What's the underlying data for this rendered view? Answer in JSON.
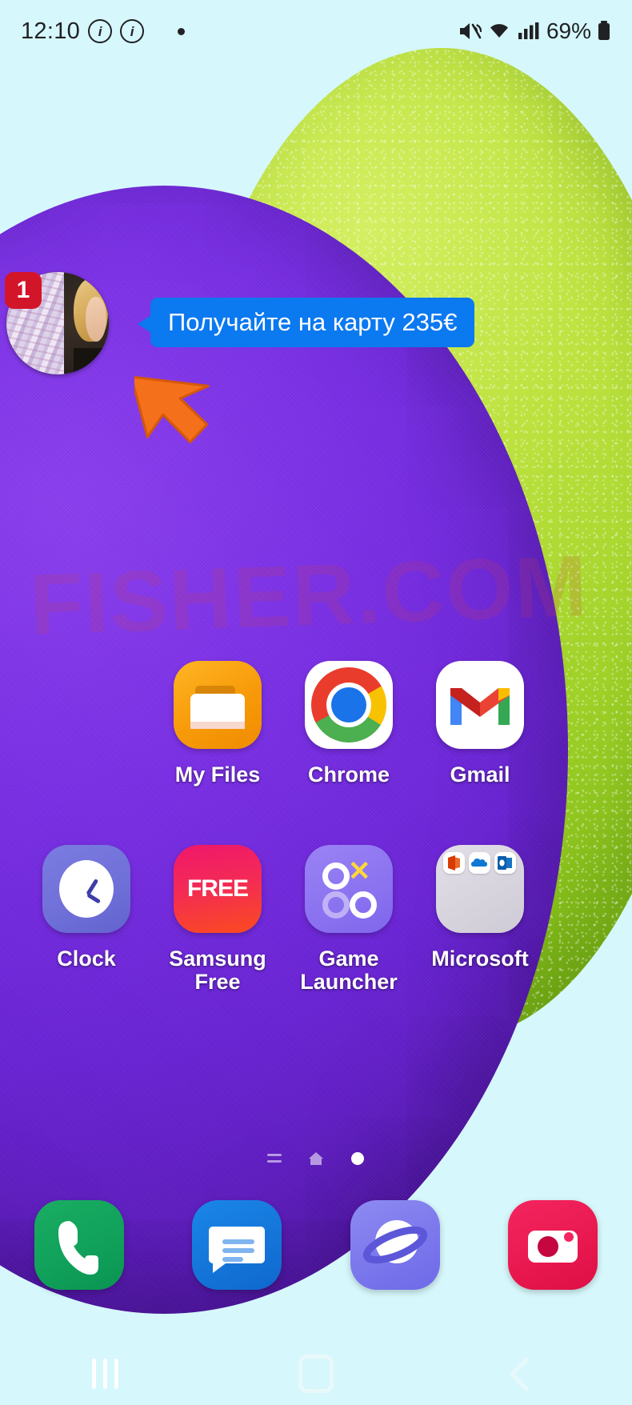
{
  "status_bar": {
    "time": "12:10",
    "info_icon_1": "info-circle-icon",
    "info_icon_2": "info-circle-icon",
    "notification_dot": "notification-dot",
    "mute_icon": "mute-vibrate-icon",
    "wifi_icon": "wifi-icon",
    "signal_icon": "cellular-signal-icon",
    "battery_percent": "69%",
    "battery_icon": "battery-icon"
  },
  "chat_head": {
    "badge_count": "1",
    "avatar": "contact-avatar"
  },
  "message_bubble": {
    "text": "Получайте на карту 235€",
    "bubble_color": "#0b79f0"
  },
  "pointer": {
    "icon": "cursor-arrow-icon",
    "color": "#f4701a"
  },
  "wallpaper": {
    "watermark": "FISHER.COM",
    "sky_color": "#d6f7fb",
    "green_color": "#a9d72b",
    "purple_color": "#7a2fe6"
  },
  "app_rows": [
    {
      "apps": [
        {
          "label": "My Files",
          "icon": "my-files-icon"
        },
        {
          "label": "Chrome",
          "icon": "chrome-icon"
        },
        {
          "label": "Gmail",
          "icon": "gmail-icon"
        }
      ]
    },
    {
      "apps": [
        {
          "label": "Clock",
          "icon": "clock-icon"
        },
        {
          "label": "Samsung Free",
          "icon": "samsung-free-icon"
        },
        {
          "label": "Game Launcher",
          "icon": "game-launcher-icon"
        },
        {
          "label": "Microsoft",
          "icon": "microsoft-folder-icon"
        }
      ]
    }
  ],
  "samsung_free_text": "FREE",
  "page_indicator": {
    "items": [
      {
        "type": "apps-page-icon",
        "active": false
      },
      {
        "type": "home-page-icon",
        "active": false
      },
      {
        "type": "dot-page-icon",
        "active": true
      }
    ]
  },
  "dock": {
    "apps": [
      {
        "label": "Phone",
        "icon": "phone-icon"
      },
      {
        "label": "Messages",
        "icon": "messages-icon"
      },
      {
        "label": "Samsung Internet",
        "icon": "samsung-internet-icon"
      },
      {
        "label": "Camera",
        "icon": "camera-icon"
      }
    ]
  },
  "nav_bar": {
    "recents": "recents-icon",
    "home": "home-icon",
    "back": "back-icon"
  }
}
